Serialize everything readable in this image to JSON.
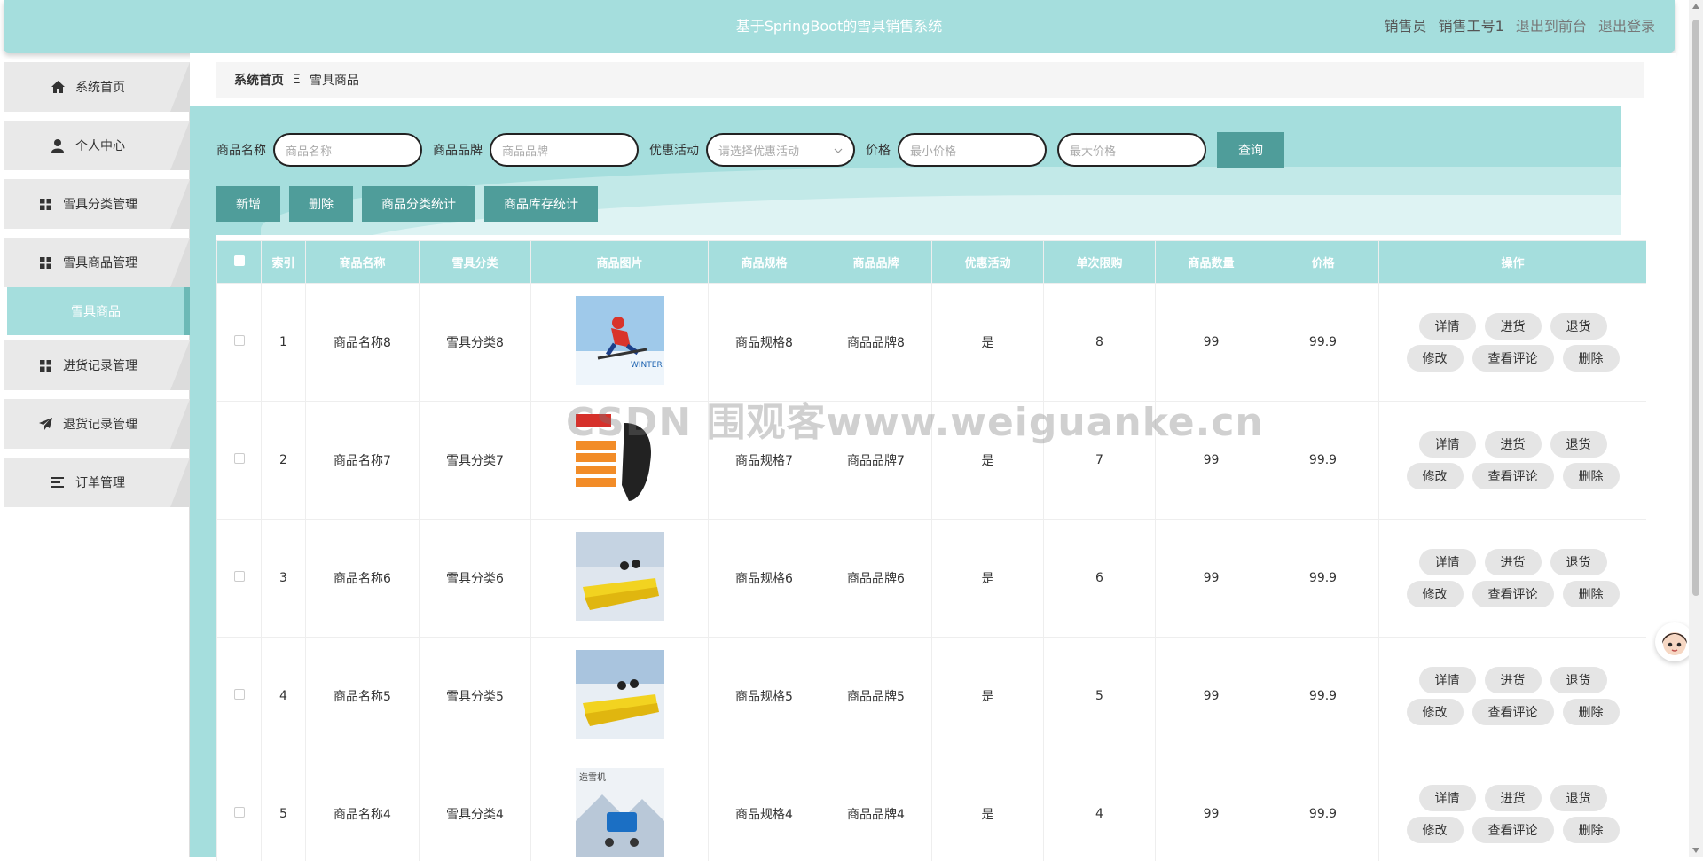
{
  "header": {
    "title": "基于SpringBoot的雪具销售系统",
    "role": "销售员",
    "user": "销售工号1",
    "to_front": "退出到前台",
    "logout": "退出登录"
  },
  "sidebar": {
    "items": [
      {
        "label": "系统首页",
        "icon": "home-icon"
      },
      {
        "label": "个人中心",
        "icon": "user-icon"
      },
      {
        "label": "雪具分类管理",
        "icon": "grid-icon"
      },
      {
        "label": "雪具商品管理",
        "icon": "grid-icon"
      },
      {
        "label": "进货记录管理",
        "icon": "grid-icon"
      },
      {
        "label": "退货记录管理",
        "icon": "send-icon"
      },
      {
        "label": "订单管理",
        "icon": "list-icon"
      }
    ],
    "active_sub": "雪具商品"
  },
  "breadcrumb": {
    "home": "系统首页",
    "sep": "Ξ",
    "current": "雪具商品"
  },
  "search": {
    "name_label": "商品名称",
    "name_placeholder": "商品名称",
    "brand_label": "商品品牌",
    "brand_placeholder": "商品品牌",
    "promo_label": "优惠活动",
    "promo_placeholder": "请选择优惠活动",
    "price_label": "价格",
    "min_placeholder": "最小价格",
    "max_placeholder": "最大价格",
    "query_button": "查询"
  },
  "actions": {
    "add": "新增",
    "delete": "删除",
    "category_stats": "商品分类统计",
    "stock_stats": "商品库存统计"
  },
  "table": {
    "headers": [
      "索引",
      "商品名称",
      "雪具分类",
      "商品图片",
      "商品规格",
      "商品品牌",
      "优惠活动",
      "单次限购",
      "商品数量",
      "价格",
      "操作"
    ],
    "op_labels": {
      "detail": "详情",
      "stock_in": "进货",
      "return": "退货",
      "edit": "修改",
      "comments": "查看评论",
      "delete": "删除"
    },
    "rows": [
      {
        "index": "1",
        "name": "商品名称8",
        "category": "雪具分类8",
        "spec": "商品规格8",
        "brand": "商品品牌8",
        "promo": "是",
        "limit": "8",
        "qty": "99",
        "price": "99.9"
      },
      {
        "index": "2",
        "name": "商品名称7",
        "category": "雪具分类7",
        "spec": "商品规格7",
        "brand": "商品品牌7",
        "promo": "是",
        "limit": "7",
        "qty": "99",
        "price": "99.9"
      },
      {
        "index": "3",
        "name": "商品名称6",
        "category": "雪具分类6",
        "spec": "商品规格6",
        "brand": "商品品牌6",
        "promo": "是",
        "limit": "6",
        "qty": "99",
        "price": "99.9"
      },
      {
        "index": "4",
        "name": "商品名称5",
        "category": "雪具分类5",
        "spec": "商品规格5",
        "brand": "商品品牌5",
        "promo": "是",
        "limit": "5",
        "qty": "99",
        "price": "99.9"
      },
      {
        "index": "5",
        "name": "商品名称4",
        "category": "雪具分类4",
        "spec": "商品规格4",
        "brand": "商品品牌4",
        "promo": "是",
        "limit": "4",
        "qty": "99",
        "price": "99.9"
      }
    ]
  },
  "watermark": "CSDN 围观客www.weiguanke.cn",
  "colors": {
    "accent": "#a5dedd",
    "button": "#4f9d9a"
  }
}
